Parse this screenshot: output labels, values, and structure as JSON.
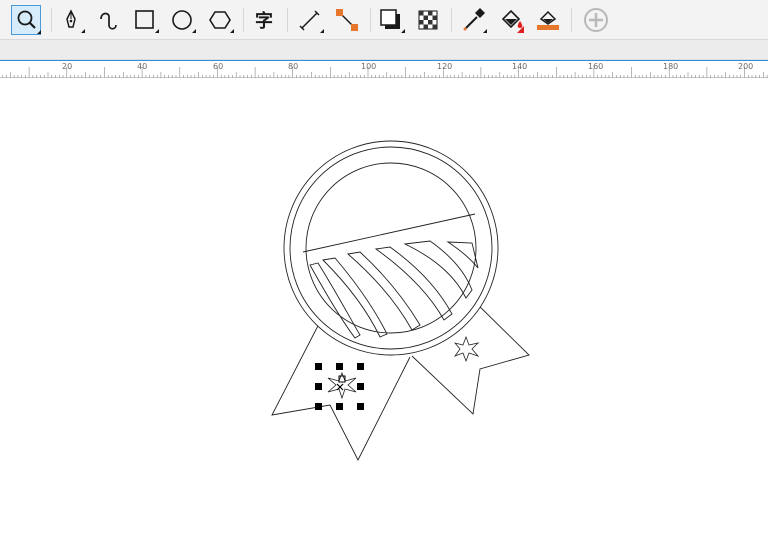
{
  "toolbar": {
    "tools": [
      {
        "name": "zoom-tool",
        "icon": "magnifier-icon",
        "active": true
      },
      {
        "name": "pen-tool",
        "icon": "pen-nib-icon"
      },
      {
        "name": "freehand-tool",
        "icon": "freehand-curve-icon"
      },
      {
        "name": "rectangle-tool",
        "icon": "rectangle-icon"
      },
      {
        "name": "ellipse-tool",
        "icon": "ellipse-icon"
      },
      {
        "name": "polygon-tool",
        "icon": "hexagon-icon"
      },
      {
        "name": "text-tool",
        "icon": "text-glyph-icon",
        "glyph": "字"
      },
      {
        "name": "dimension-tool",
        "icon": "dimension-line-icon"
      },
      {
        "name": "connector-tool",
        "icon": "connector-icon"
      },
      {
        "name": "drop-shadow-tool",
        "icon": "drop-shadow-icon"
      },
      {
        "name": "transparency-tool",
        "icon": "checkerboard-icon"
      },
      {
        "name": "eyedropper-tool",
        "icon": "eyedropper-icon"
      },
      {
        "name": "interactive-fill-tool",
        "icon": "paint-bucket-icon"
      },
      {
        "name": "smart-fill-tool",
        "icon": "smart-fill-icon"
      },
      {
        "name": "add-tool-button",
        "icon": "plus-circle-icon"
      }
    ]
  },
  "ruler": {
    "unit_labels": [
      "20",
      "40",
      "60",
      "80",
      "100",
      "120",
      "140",
      "160",
      "180",
      "200"
    ]
  },
  "colors": {
    "accent": "#2f8fd8",
    "tool_orange": "#e8772e",
    "tool_red": "#e02020",
    "drawing_stroke": "#222222",
    "selection_handle": "#000000"
  },
  "canvas": {
    "drawing": "badge-with-ribbons",
    "selected_object": "small-star-on-left-ribbon"
  }
}
